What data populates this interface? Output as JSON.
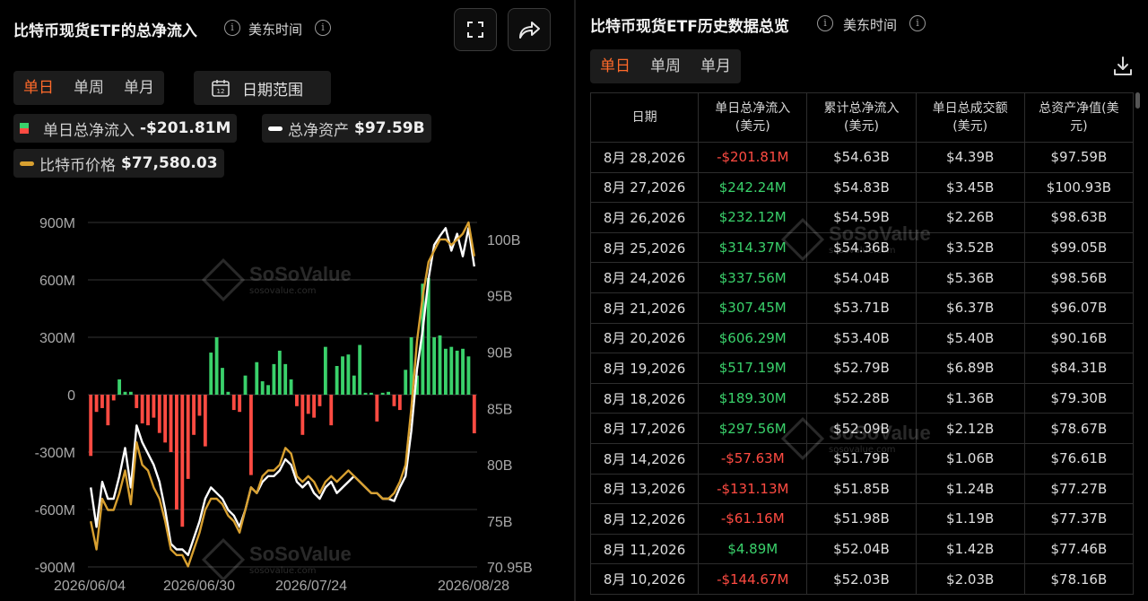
{
  "left_panel": {
    "title": "比特币现货ETF的总净流入",
    "timezone": "美东时间",
    "tabs": [
      {
        "label": "单日",
        "active": true
      },
      {
        "label": "单周",
        "active": false
      },
      {
        "label": "单月",
        "active": false
      }
    ],
    "date_range_label": "日期范围",
    "legend": {
      "net_inflow_label": "单日总净流入",
      "net_inflow_value": "-$201.81M",
      "total_assets_label": "总净资产",
      "total_assets_value": "$97.59B",
      "btc_price_label": "比特币价格",
      "btc_price_value": "$77,580.03"
    },
    "watermark": "SoSoValue",
    "watermark_sub": "sosovalue.com"
  },
  "chart_data": {
    "type": "bar",
    "left_axis_ticks": [
      "900M",
      "600M",
      "300M",
      "0",
      "-300M",
      "-600M",
      "-900M"
    ],
    "right_axis_ticks": [
      "100B",
      "95B",
      "90B",
      "85B",
      "80B",
      "75B",
      "70.95B"
    ],
    "x_tick_labels": [
      "2026/06/04",
      "2026/06/30",
      "2026/07/24",
      "2026/08/28"
    ],
    "ylim_left": [
      -900,
      900
    ],
    "ylim_right": [
      70.95,
      101.5
    ],
    "net_inflow_millions": [
      -320,
      -90,
      -70,
      -160,
      -30,
      80,
      15,
      15,
      -70,
      -150,
      -160,
      -120,
      -200,
      -250,
      -300,
      -600,
      -690,
      -440,
      -210,
      -110,
      -270,
      220,
      300,
      140,
      15,
      -80,
      -90,
      100,
      -420,
      170,
      70,
      50,
      160,
      230,
      160,
      80,
      -60,
      -210,
      -100,
      -120,
      -60,
      250,
      -160,
      150,
      200,
      210,
      100,
      260,
      10,
      10,
      -140,
      10,
      15,
      -60,
      -80,
      130,
      300,
      100,
      580,
      610,
      300,
      310,
      240,
      250,
      230,
      240,
      200,
      -201.81
    ],
    "bar_colors": {
      "positive": "#3ad16b",
      "negative": "#ff4b42"
    },
    "series": [
      {
        "name": "总净资产",
        "color": "#ffffff",
        "values": [
          78.0,
          74.5,
          78.5,
          77.0,
          77.0,
          79.0,
          81.5,
          78.0,
          83.5,
          82.0,
          81.0,
          80.0,
          78.5,
          76.0,
          73.0,
          72.5,
          72.5,
          72.0,
          73.5,
          75.0,
          77.0,
          78.0,
          77.5,
          77.0,
          76.0,
          75.5,
          74.5,
          76.0,
          78.0,
          77.5,
          78.5,
          79.0,
          79.0,
          79.5,
          80.5,
          80.0,
          78.5,
          78.0,
          78.5,
          77.5,
          77.0,
          78.0,
          78.5,
          77.5,
          78.0,
          78.5,
          79.0,
          78.5,
          78.0,
          77.5,
          77.5,
          77.0,
          77.0,
          76.8,
          78.0,
          79.0,
          83.0,
          88.5,
          92.0,
          96.5,
          99.5,
          100.3,
          101.0,
          99.0,
          100.5,
          98.5,
          101.0,
          97.59
        ]
      },
      {
        "name": "比特币价格",
        "color": "#d8a030",
        "values": [
          75.0,
          72.5,
          77.0,
          76.0,
          76.0,
          77.5,
          79.5,
          76.5,
          82.0,
          80.0,
          79.5,
          78.0,
          77.0,
          75.0,
          72.5,
          72.0,
          72.0,
          71.0,
          72.5,
          74.0,
          76.0,
          77.0,
          77.0,
          76.5,
          75.5,
          75.0,
          74.0,
          76.0,
          78.0,
          77.5,
          79.0,
          79.5,
          79.5,
          80.0,
          81.5,
          81.0,
          79.0,
          78.5,
          79.0,
          78.5,
          77.5,
          78.5,
          79.0,
          78.5,
          79.0,
          79.5,
          79.0,
          78.5,
          78.0,
          77.5,
          77.5,
          77.0,
          77.0,
          77.5,
          78.5,
          80.0,
          85.0,
          91.0,
          95.0,
          98.0,
          99.0,
          100.0,
          100.0,
          99.5,
          100.0,
          100.5,
          101.5,
          98.5
        ]
      }
    ]
  },
  "right_panel": {
    "title": "比特币现货ETF历史数据总览",
    "timezone": "美东时间",
    "tabs": [
      {
        "label": "单日",
        "active": true
      },
      {
        "label": "单周",
        "active": false
      },
      {
        "label": "单月",
        "active": false
      }
    ],
    "columns": [
      [
        "日期"
      ],
      [
        "单日总净流入",
        "(美元)"
      ],
      [
        "累计总净流入",
        "(美元)"
      ],
      [
        "单日总成交额",
        "(美元)"
      ],
      [
        "总资产净值(美",
        "元)"
      ]
    ],
    "rows": [
      {
        "date": "8月 28,2026",
        "net": "-$201.81M",
        "cum": "$54.63B",
        "vol": "$4.39B",
        "nav": "$97.59B",
        "sign": "neg"
      },
      {
        "date": "8月 27,2026",
        "net": "$242.24M",
        "cum": "$54.83B",
        "vol": "$3.45B",
        "nav": "$100.93B",
        "sign": "pos"
      },
      {
        "date": "8月 26,2026",
        "net": "$232.12M",
        "cum": "$54.59B",
        "vol": "$2.26B",
        "nav": "$98.63B",
        "sign": "pos"
      },
      {
        "date": "8月 25,2026",
        "net": "$314.37M",
        "cum": "$54.36B",
        "vol": "$3.52B",
        "nav": "$99.05B",
        "sign": "pos"
      },
      {
        "date": "8月 24,2026",
        "net": "$337.56M",
        "cum": "$54.04B",
        "vol": "$5.36B",
        "nav": "$98.56B",
        "sign": "pos"
      },
      {
        "date": "8月 21,2026",
        "net": "$307.45M",
        "cum": "$53.71B",
        "vol": "$6.37B",
        "nav": "$96.07B",
        "sign": "pos"
      },
      {
        "date": "8月 20,2026",
        "net": "$606.29M",
        "cum": "$53.40B",
        "vol": "$5.40B",
        "nav": "$90.16B",
        "sign": "pos"
      },
      {
        "date": "8月 19,2026",
        "net": "$517.19M",
        "cum": "$52.79B",
        "vol": "$6.89B",
        "nav": "$84.31B",
        "sign": "pos"
      },
      {
        "date": "8月 18,2026",
        "net": "$189.30M",
        "cum": "$52.28B",
        "vol": "$1.36B",
        "nav": "$79.30B",
        "sign": "pos"
      },
      {
        "date": "8月 17,2026",
        "net": "$297.56M",
        "cum": "$52.09B",
        "vol": "$2.12B",
        "nav": "$78.67B",
        "sign": "pos"
      },
      {
        "date": "8月 14,2026",
        "net": "-$57.63M",
        "cum": "$51.79B",
        "vol": "$1.06B",
        "nav": "$76.61B",
        "sign": "neg"
      },
      {
        "date": "8月 13,2026",
        "net": "-$131.13M",
        "cum": "$51.85B",
        "vol": "$1.24B",
        "nav": "$77.27B",
        "sign": "neg"
      },
      {
        "date": "8月 12,2026",
        "net": "-$61.16M",
        "cum": "$51.98B",
        "vol": "$1.19B",
        "nav": "$77.37B",
        "sign": "neg"
      },
      {
        "date": "8月 11,2026",
        "net": "$4.89M",
        "cum": "$52.04B",
        "vol": "$1.42B",
        "nav": "$77.46B",
        "sign": "pos"
      },
      {
        "date": "8月 10,2026",
        "net": "-$144.67M",
        "cum": "$52.03B",
        "vol": "$2.03B",
        "nav": "$78.16B",
        "sign": "neg"
      }
    ],
    "watermark": "SoSoValue",
    "watermark_sub": "sosovalue.com"
  },
  "icons": [
    "info-icon",
    "fullscreen-icon",
    "share-icon",
    "calendar-icon",
    "download-icon"
  ]
}
